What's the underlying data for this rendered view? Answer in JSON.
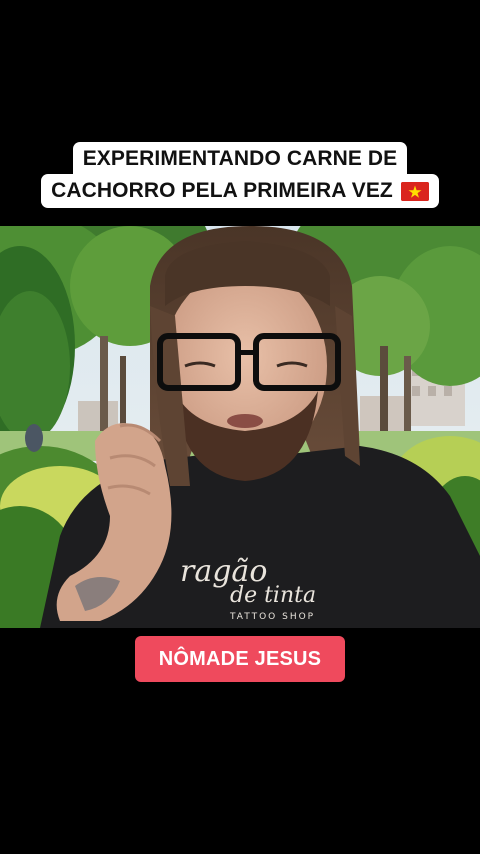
{
  "caption": {
    "line1": "EXPERIMENTANDO CARNE DE",
    "line2": "CACHORRO PELA PRIMEIRA VEZ",
    "flag_icon": "vietnam-flag-icon",
    "flag_color": "#da251d",
    "flag_star_color": "#ffde00"
  },
  "shirt": {
    "brand_line1": "ragão",
    "brand_line2": "de tinta",
    "brand_line3": "TATTOO SHOP"
  },
  "name_tag": {
    "label": "NÔMADE JESUS",
    "color": "#ef4a5d"
  }
}
